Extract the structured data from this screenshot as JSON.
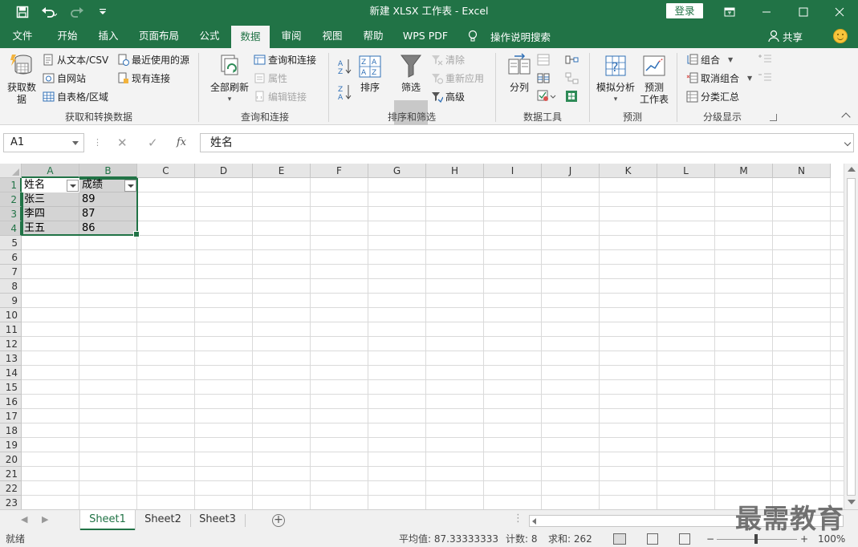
{
  "window": {
    "title": "新建 XLSX 工作表  -  Excel",
    "login_label": "登录",
    "share_label": "共享",
    "search_label": "操作说明搜索"
  },
  "tabs": [
    "文件",
    "开始",
    "插入",
    "页面布局",
    "公式",
    "数据",
    "审阅",
    "视图",
    "帮助",
    "WPS PDF"
  ],
  "active_tab": "数据",
  "ribbon": {
    "get_data": {
      "big_label_1": "获取数",
      "big_label_2": "据",
      "from_text": "从文本/CSV",
      "from_web": "自网站",
      "from_table": "自表格/区域",
      "recent_sources": "最近使用的源",
      "existing_conn": "现有连接",
      "group": "获取和转换数据"
    },
    "queries": {
      "refresh_all": "全部刷新",
      "queries_conn": "查询和连接",
      "properties": "属性",
      "edit_links": "编辑链接",
      "group": "查询和连接"
    },
    "sort_filter": {
      "sort": "排序",
      "filter": "筛选",
      "clear": "清除",
      "reapply": "重新应用",
      "advanced": "高级",
      "group": "排序和筛选"
    },
    "data_tools": {
      "split": "分列",
      "group": "数据工具"
    },
    "forecast": {
      "what_if": "模拟分析",
      "forecast_sheet_1": "预测",
      "forecast_sheet_2": "工作表",
      "group": "预测"
    },
    "outline": {
      "group_btn": "组合",
      "ungroup": "取消组合",
      "subtotal": "分类汇总",
      "group": "分级显示"
    }
  },
  "formula_bar": {
    "name_box": "A1",
    "fx": "fx",
    "content": "姓名"
  },
  "grid": {
    "columns": [
      "A",
      "B",
      "C",
      "D",
      "E",
      "F",
      "G",
      "H",
      "I",
      "J",
      "K",
      "L",
      "M",
      "N"
    ],
    "rows": [
      "1",
      "2",
      "3",
      "4",
      "5",
      "6",
      "7",
      "8",
      "9",
      "10",
      "11",
      "12",
      "13",
      "14",
      "15",
      "16",
      "17",
      "18",
      "19",
      "20",
      "21",
      "22",
      "23"
    ],
    "header": [
      "姓名",
      "成绩"
    ],
    "data": [
      [
        "张三",
        "89"
      ],
      [
        "李四",
        "87"
      ],
      [
        "王五",
        "86"
      ]
    ]
  },
  "sheets": [
    "Sheet1",
    "Sheet2",
    "Sheet3"
  ],
  "active_sheet": "Sheet1",
  "status": {
    "ready": "就绪",
    "average": "平均值: 87.33333333",
    "count": "计数: 8",
    "sum": "求和: 262",
    "zoom": "100%"
  },
  "watermark": "最需教育",
  "colors": {
    "brand": "#217346",
    "selection_fill": "#a0a0a0"
  }
}
